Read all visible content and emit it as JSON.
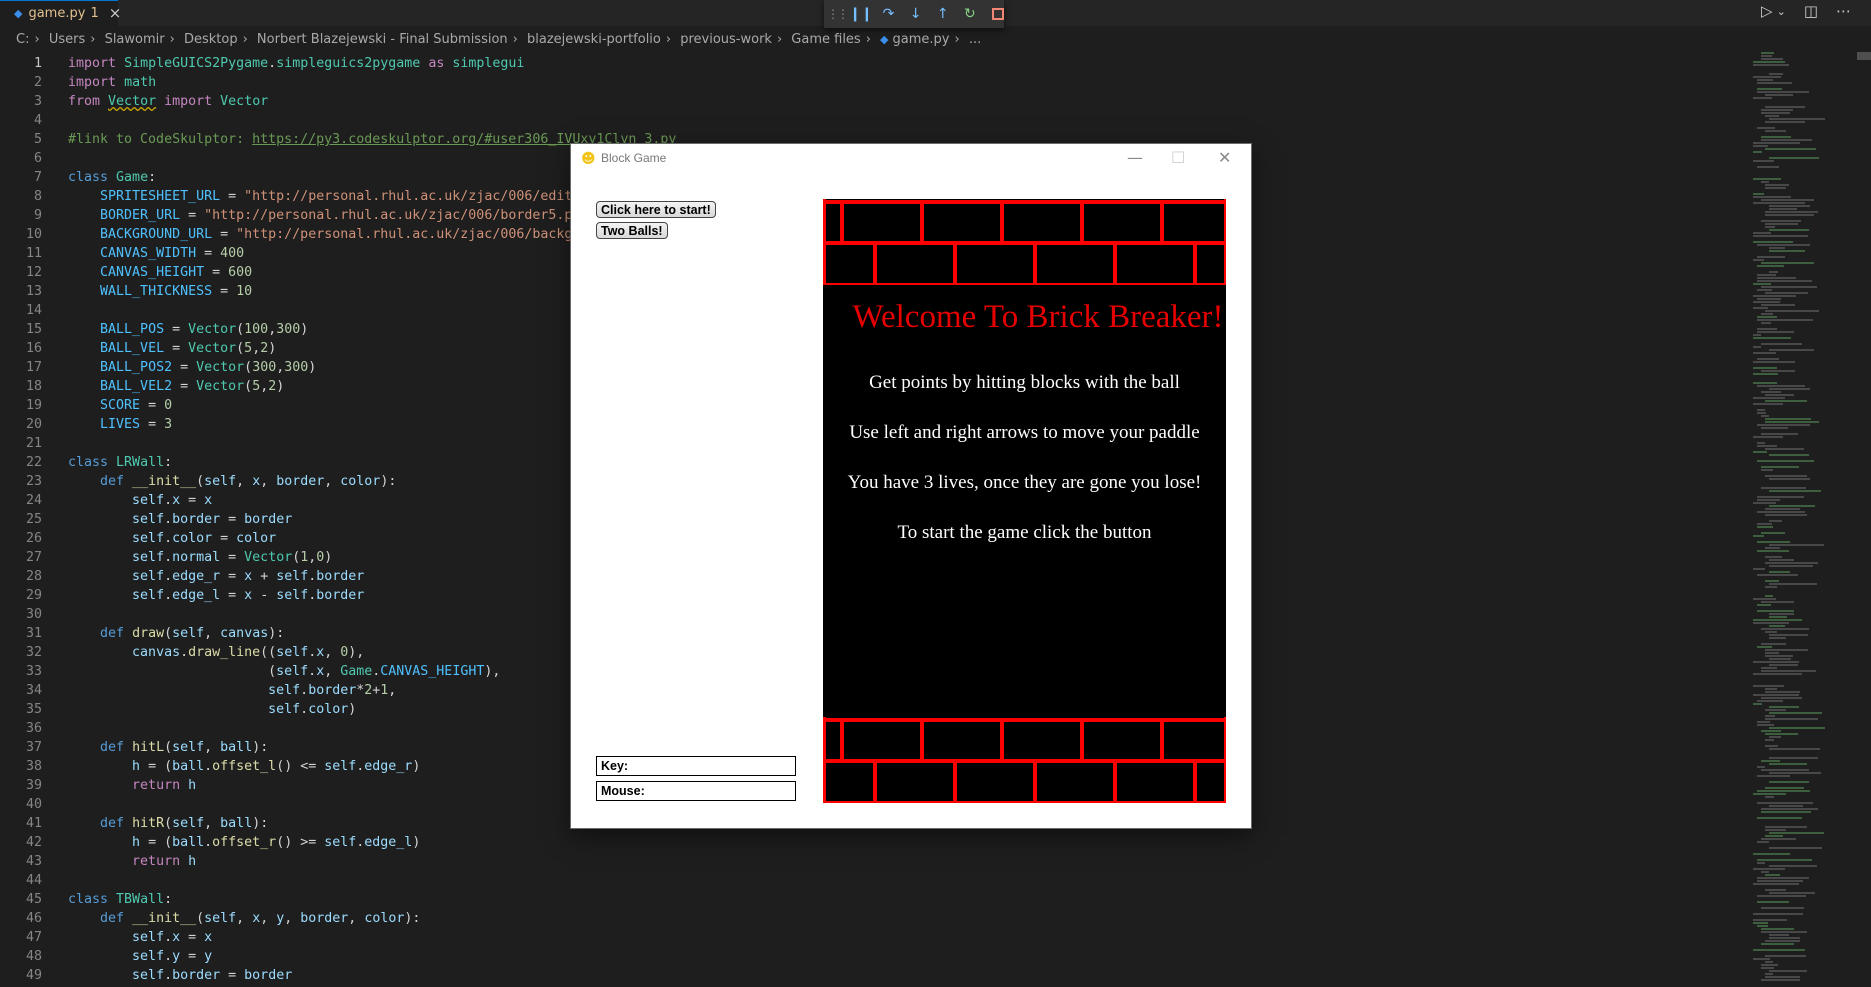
{
  "tab": {
    "filename": "game.py",
    "badge": "1",
    "close_icon": "×",
    "file_icon": "python-file-icon"
  },
  "debug_toolbar": {
    "actions": [
      "drag-handle",
      "pause",
      "step-over",
      "step-into",
      "step-out",
      "restart",
      "stop"
    ]
  },
  "top_right": {
    "run_icon": "▷",
    "dropdown_icon": "⌄",
    "split_icon": "◫",
    "more_icon": "⋯"
  },
  "breadcrumb": [
    "C:",
    "Users",
    "Slawomir",
    "Desktop",
    "Norbert Blazejewski - Final Submission",
    "blazejewski-portfolio",
    "previous-work",
    "Game files",
    "game.py",
    "..."
  ],
  "editor": {
    "active_line": 1,
    "lines": [
      "1",
      "2",
      "3",
      "4",
      "5",
      "6",
      "7",
      "8",
      "9",
      "10",
      "11",
      "12",
      "13",
      "14",
      "15",
      "16",
      "17",
      "18",
      "19",
      "20",
      "21",
      "22",
      "23",
      "24",
      "25",
      "26",
      "27",
      "28",
      "29",
      "30",
      "31",
      "32",
      "33",
      "34",
      "35",
      "36",
      "37",
      "38",
      "39",
      "40",
      "41",
      "42",
      "43",
      "44",
      "45",
      "46",
      "47",
      "48",
      "49"
    ]
  },
  "game_window": {
    "title": "Block Game",
    "icon": "pygame-snake-icon",
    "controls": {
      "minimize": "—",
      "maximize": "☐",
      "close": "✕"
    },
    "buttons": {
      "start": "Click here to start!",
      "two_balls": "Two Balls!"
    },
    "status": {
      "key_label": "Key:",
      "mouse_label": "Mouse:"
    },
    "canvas": {
      "headline": "Welcome To Brick Breaker!",
      "messages": [
        "Get points by hitting blocks with the ball",
        "Use left and right arrows to move your paddle",
        "You have 3 lives, once they are gone you lose!",
        "To start the game click the button"
      ],
      "brick_color": "#ff0000",
      "headline_color": "#e60000",
      "background": "#000000"
    }
  },
  "colors": {
    "editor_bg": "#1e1e1e",
    "keyword": "#c586c0",
    "string": "#ce9178",
    "number": "#b5cea8",
    "function": "#dcdcaa",
    "class": "#4ec9b0",
    "comment": "#6a9955"
  }
}
